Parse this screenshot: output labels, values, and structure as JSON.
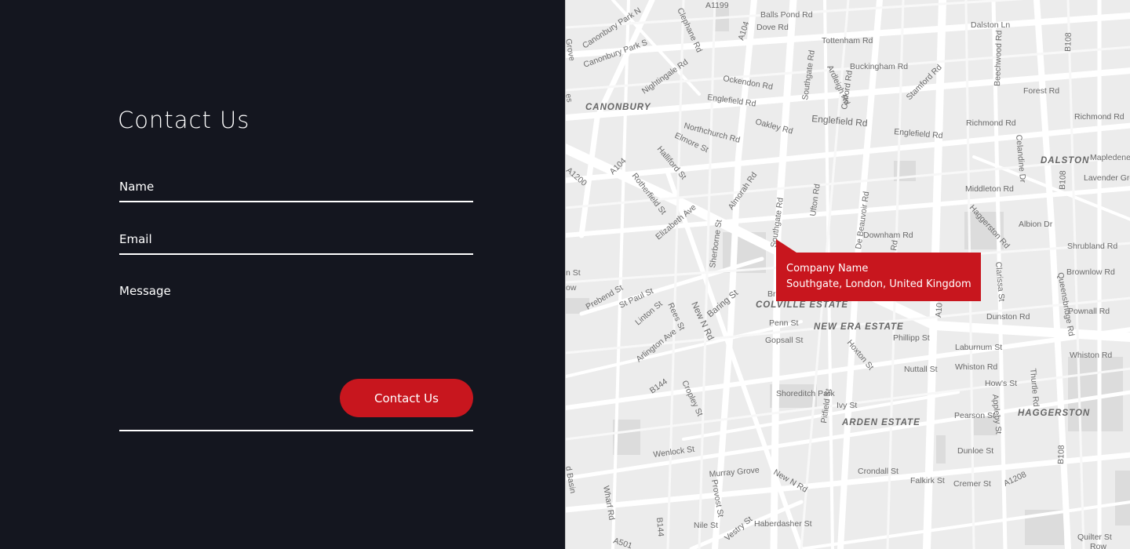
{
  "form": {
    "title": "Contact Us",
    "name_placeholder": "Name",
    "email_placeholder": "Email",
    "message_placeholder": "Message",
    "submit_label": "Contact Us"
  },
  "map": {
    "marker": {
      "company": "Company Name",
      "address": "Southgate, London, United Kingdom"
    },
    "labels": {
      "a1199": "A1199",
      "balls_pond": "Balls Pond Rd",
      "dove": "Dove Rd",
      "dalston_ln": "Dalston Ln",
      "canonbury_pk_n": "Canonbury Park N",
      "canonbury_pk_s": "Canonbury Park S",
      "clephane": "Clephane Rd",
      "a104_top": "A104",
      "tottenham": "Tottenham Rd",
      "buckingham": "Buckingham Rd",
      "beechwood": "Beechwood Rd",
      "b108_top": "B108",
      "grove": "Grove",
      "nightingale": "Nightingale Rd",
      "ockendon": "Ockendon Rd",
      "southgate_top": "Southgate Rd",
      "ardleigh": "Ardleigh Rd",
      "culford": "Culford Rd",
      "stamford": "Stamford Rd",
      "forest": "Forest Rd",
      "canonbury": "CANONBURY",
      "englefield_1": "Englefield Rd",
      "englefield_2": "Englefield Rd",
      "englefield_3": "Englefield Rd",
      "richmond_1": "Richmond Rd",
      "richmond_2": "Richmond Rd",
      "northchurch": "Northchurch Rd",
      "oakley": "Oakley Rd",
      "elmore": "Elmore St",
      "celandine": "Celandine Dr",
      "dalston": "DALSTON",
      "mapledene": "Mapledene",
      "hallifard": "Halliford St",
      "a104_mid": "A104",
      "a1200": "A1200",
      "b108_mid": "B108",
      "lavender": "Lavender Grove",
      "rotherfield": "Rotherfield St",
      "almorah": "Almorah Rd",
      "southgate_mid": "Southgate Rd",
      "ufton": "Ufton Rd",
      "de_beauvoir": "De Beauvoir Rd",
      "middleton": "Middleton Rd",
      "elizabeth": "Elizabeth Ave",
      "haggerston_rd": "Haggerston Rd",
      "albion": "Albion Dr",
      "sherborne": "Sherborne St",
      "downham": "Downham Rd",
      "shrubland": "Shrubland Rd",
      "clarissa": "Clarissa St",
      "brownlow": "Brownlow Rd",
      "queensbridge": "Queensbridge Rd",
      "prebend": "Prebend St",
      "st_paul": "St Paul St",
      "new_n_rd_1": "New N Rd",
      "baring": "Baring St",
      "colville": "COLVILLE ESTATE",
      "linton": "Linton St",
      "rees": "Rees St",
      "penn": "Penn St",
      "new_era": "NEW ERA ESTATE",
      "dunston": "Dunston Rd",
      "pownall": "Pownall Rd",
      "arlington": "Arlington Ave",
      "gopsall": "Gopsall St",
      "hoxton": "Hoxton St",
      "phillipp": "Phillipp St",
      "laburnum": "Laburnum St",
      "whiston_1": "Whiston Rd",
      "whiston_2": "Whiston Rd",
      "nuttall": "Nuttall St",
      "hows": "How's St",
      "thurtle": "Thurtle Rd",
      "b144_1": "B144",
      "cropley": "Cropley St",
      "shoreditch_park": "Shoreditch Park",
      "pitfield": "Pitfield St",
      "ivy": "Ivy St",
      "arden": "ARDEN ESTATE",
      "pearson": "Pearson St",
      "appleby": "Appleby St",
      "haggerston": "HAGGERSTON",
      "wenlock": "Wenlock St",
      "dunloe": "Dunloe St",
      "b108_bot": "B108",
      "murray": "Murray Grove",
      "new_n_rd_2": "New N Rd",
      "crondall": "Crondall St",
      "falkirk": "Falkirk St",
      "cremer": "Cremer St",
      "a1208": "A1208",
      "provost": "Provost St",
      "wharf": "Wharf Rd",
      "basin": "d Basin",
      "b144_2": "B144",
      "nile": "Nile St",
      "vestry": "Vestry St",
      "haberdasher": "Haberdasher St",
      "a501": "A501",
      "quilter": "Quilter St",
      "row": "Row",
      "n_st": "n St",
      "ow": "ow",
      "es": "es",
      "br": "Br",
      "rd_small": "Rd",
      "a10": "A10"
    }
  }
}
